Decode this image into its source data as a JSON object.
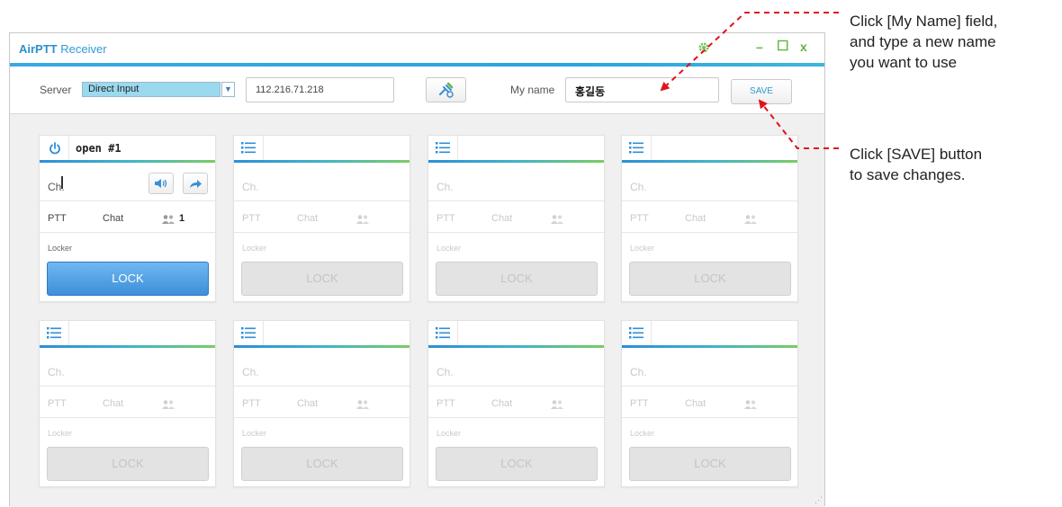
{
  "window": {
    "title_brand": "AirPTT",
    "title_rest": " Receiver",
    "controls": {
      "minimize": "–",
      "maximize": "☐",
      "close": "x"
    }
  },
  "toolbar": {
    "server_label": "Server",
    "server_value": "Direct Input",
    "server_address": "112.216.71.218",
    "myname_label": "My name",
    "myname_value": "홍길동",
    "save_label": "SAVE"
  },
  "channels": [
    {
      "name": "open #1",
      "ch": "Ch.",
      "ptt": "PTT",
      "chat": "Chat",
      "users": "1",
      "locker": "Locker",
      "lock": "LOCK"
    },
    {
      "ch": "Ch.",
      "ptt": "PTT",
      "chat": "Chat",
      "locker": "Locker",
      "lock": "LOCK"
    },
    {
      "ch": "Ch.",
      "ptt": "PTT",
      "chat": "Chat",
      "locker": "Locker",
      "lock": "LOCK"
    },
    {
      "ch": "Ch.",
      "ptt": "PTT",
      "chat": "Chat",
      "locker": "Locker",
      "lock": "LOCK"
    },
    {
      "ch": "Ch.",
      "ptt": "PTT",
      "chat": "Chat",
      "locker": "Locker",
      "lock": "LOCK"
    },
    {
      "ch": "Ch.",
      "ptt": "PTT",
      "chat": "Chat",
      "locker": "Locker",
      "lock": "LOCK"
    },
    {
      "ch": "Ch.",
      "ptt": "PTT",
      "chat": "Chat",
      "locker": "Locker",
      "lock": "LOCK"
    },
    {
      "ch": "Ch.",
      "ptt": "PTT",
      "chat": "Chat",
      "locker": "Locker",
      "lock": "LOCK"
    }
  ],
  "callouts": {
    "name_field": [
      "Click [My Name] field,",
      "and type a new name",
      "you want to use"
    ],
    "save_button": [
      "Click [SAVE] button",
      "to save changes."
    ]
  },
  "colors": {
    "accent": "#2aa4e4",
    "lock_active": "#3d8fd9",
    "callout_arrow": "#e0121b"
  }
}
